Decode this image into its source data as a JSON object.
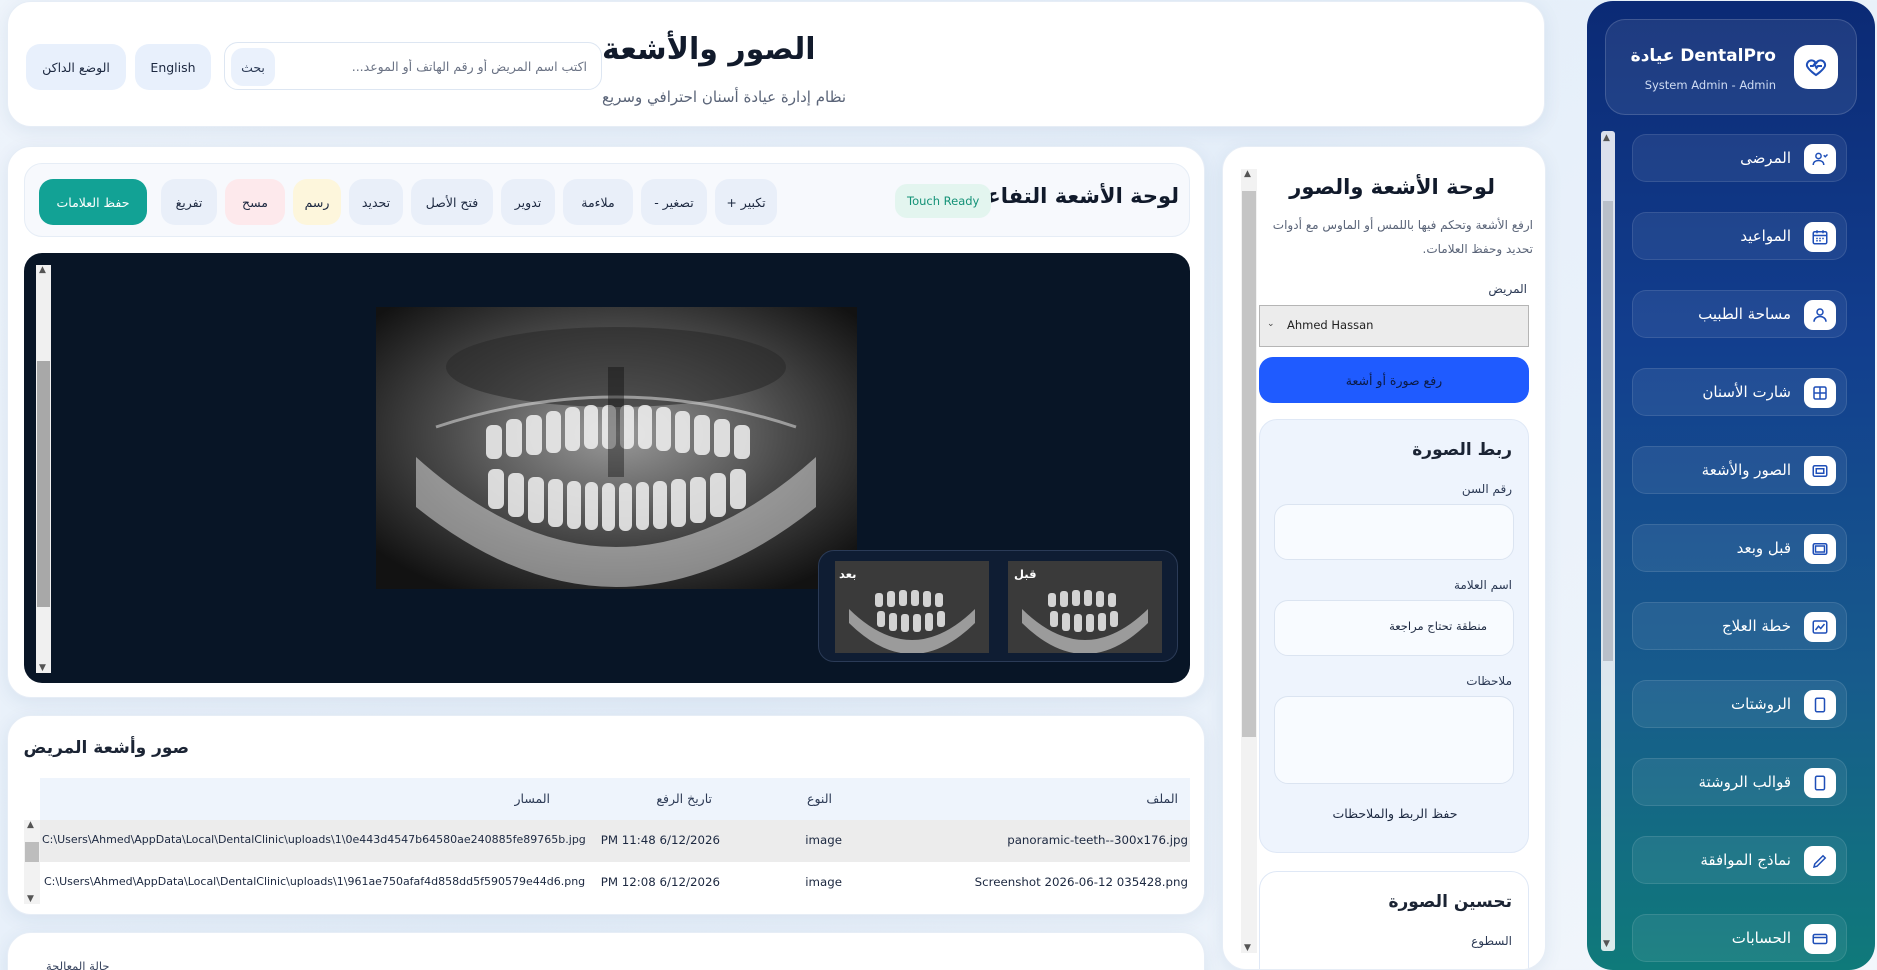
{
  "sidebar": {
    "brand_title": "DentalPro عيادة",
    "brand_subtitle": "System Admin - Admin",
    "items": [
      {
        "label": "المرضى"
      },
      {
        "label": "المواعيد"
      },
      {
        "label": "مساحة الطبيب"
      },
      {
        "label": "شارت الأسنان"
      },
      {
        "label": "الصور والأشعة"
      },
      {
        "label": "قبل وبعد"
      },
      {
        "label": "خطة العلاج"
      },
      {
        "label": "الروشتات"
      },
      {
        "label": "قوالب الروشتة"
      },
      {
        "label": "نماذج الموافقة"
      },
      {
        "label": "الحسابات"
      }
    ]
  },
  "header": {
    "title": "الصور والأشعة",
    "subtitle": "نظام إدارة عيادة أسنان احترافي وسريع",
    "search_placeholder": "اكتب اسم المريض أو رقم الهاتف أو الموعد...",
    "search_button": "بحث",
    "language_button": "English",
    "dark_mode_button": "الوضع الداكن"
  },
  "viewer": {
    "title": "لوحة الأشعة التفاعلية",
    "badge": "Touch Ready",
    "tools": {
      "zoom_in": "تكبير +",
      "zoom_out": "تصغير -",
      "fit": "ملاءمة",
      "rotate": "تدوير",
      "open_original": "فتح الأصل",
      "select": "تحديد",
      "draw": "رسم",
      "erase": "مسح",
      "clear": "تفريغ",
      "save_marks": "حفظ العلامات"
    },
    "compare": {
      "before": "قبل",
      "after": "بعد"
    }
  },
  "files": {
    "title": "صور وأشعة المريض",
    "columns": {
      "file": "الملف",
      "type": "النوع",
      "uploaded": "تاريخ الرفع",
      "path": "المسار"
    },
    "rows": [
      {
        "file": "panoramic-teeth--300x176.jpg",
        "type": "image",
        "uploaded": "PM 11:48 6/12/2026",
        "path": "C:\\Users\\Ahmed\\AppData\\Local\\DentalClinic\\uploads\\1\\0e443d4547b64580ae240885fe89765b.jpg"
      },
      {
        "file": "Screenshot 2026-06-12 035428.png",
        "type": "image",
        "uploaded": "PM 12:08 6/12/2026",
        "path": "C:\\Users\\Ahmed\\AppData\\Local\\DentalClinic\\uploads\\1\\961ae750afaf4d858dd5f590579e44d6.png"
      }
    ]
  },
  "next_card": {
    "label": "حالة المعالجة"
  },
  "panel": {
    "title": "لوحة الأشعة والصور",
    "description": "ارفع الأشعة وتحكم فيها باللمس أو الماوس مع أدوات تحديد وحفظ العلامات.",
    "patient_label": "المريض",
    "patient_value": "Ahmed Hassan",
    "upload_button": "رفع صورة أو أشعة",
    "link": {
      "title": "ربط الصورة",
      "tooth_label": "رقم السن",
      "tooth_value": "",
      "mark_label": "اسم العلامة",
      "mark_value": "منطقة تحتاج مراجعة",
      "notes_label": "ملاحظات",
      "notes_value": "",
      "save_button": "حفظ الربط والملاحظات"
    },
    "enhance": {
      "title": "تحسين الصورة",
      "brightness_label": "السطوع"
    }
  },
  "colors": {
    "accent_blue": "#1f5bff",
    "save_teal": "#12a295",
    "sidebar_top": "#0b2a75",
    "sidebar_bottom": "#0f7a7a",
    "stage_bg": "#081526"
  }
}
